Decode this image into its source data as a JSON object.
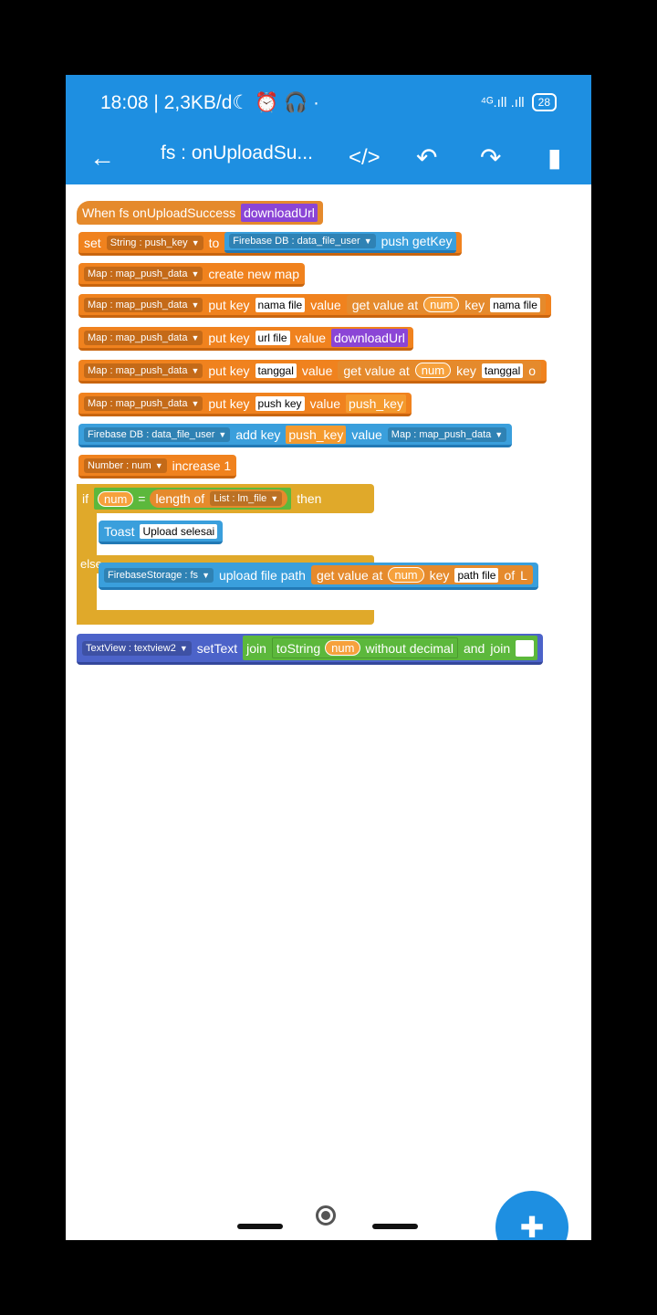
{
  "status": {
    "time": "18:08 | 2,3KB/d☾ ⏰ 🎧 ·",
    "signal": "⁴ᴳ.ıll .ıll",
    "battery": "28"
  },
  "appbar": {
    "title": "fs : onUploadSu...",
    "code": "</>",
    "undo": "↶",
    "redo": "↷",
    "bookmark": "▮",
    "back": "←"
  },
  "blocks": {
    "event": {
      "label": "When fs onUploadSuccess",
      "param": "downloadUrl"
    },
    "set": {
      "set": "set",
      "var": "String : push_key",
      "to": "to",
      "db": "Firebase DB : data_file_user",
      "getkey": "push getKey"
    },
    "map_create": {
      "var": "Map : map_push_data",
      "action": "create new map"
    },
    "put1": {
      "var": "Map : map_push_data",
      "put": "put key",
      "key": "nama file",
      "value": "value",
      "get": "get value at",
      "num": "num",
      "k": "key",
      "k2": "nama file"
    },
    "put2": {
      "var": "Map : map_push_data",
      "put": "put key",
      "key": "url file",
      "value": "value",
      "v": "downloadUrl"
    },
    "put3": {
      "var": "Map : map_push_data",
      "put": "put key",
      "key": "tanggal",
      "value": "value",
      "get": "get value at",
      "num": "num",
      "k": "key",
      "k2": "tanggal",
      "of": "o"
    },
    "put4": {
      "var": "Map : map_push_data",
      "put": "put key",
      "key": "push key",
      "value": "value",
      "v": "push_key"
    },
    "fbadd": {
      "var": "Firebase DB : data_file_user",
      "add": "add key",
      "key": "push_key",
      "value": "value",
      "map": "Map : map_push_data"
    },
    "inc": {
      "var": "Number : num",
      "action": "increase 1"
    },
    "if": {
      "if": "if",
      "num": "num",
      "eq": "=",
      "len": "length of",
      "list": "List : lm_file",
      "then": "then"
    },
    "toast": {
      "label": "Toast",
      "text": "Upload selesai"
    },
    "else": {
      "label": "else"
    },
    "upload": {
      "var": "FirebaseStorage : fs",
      "action": "upload file path",
      "get": "get value at",
      "num": "num",
      "k": "key",
      "k2": "path file",
      "of": "of",
      "cut": "L"
    },
    "settext": {
      "var": "TextView : textview2",
      "action": "setText",
      "join": "join",
      "tostring": "toString",
      "num": "num",
      "wd": "without decimal",
      "and": "and",
      "join2": "join"
    }
  },
  "fab": {
    "icon": "puzzle-piece"
  }
}
